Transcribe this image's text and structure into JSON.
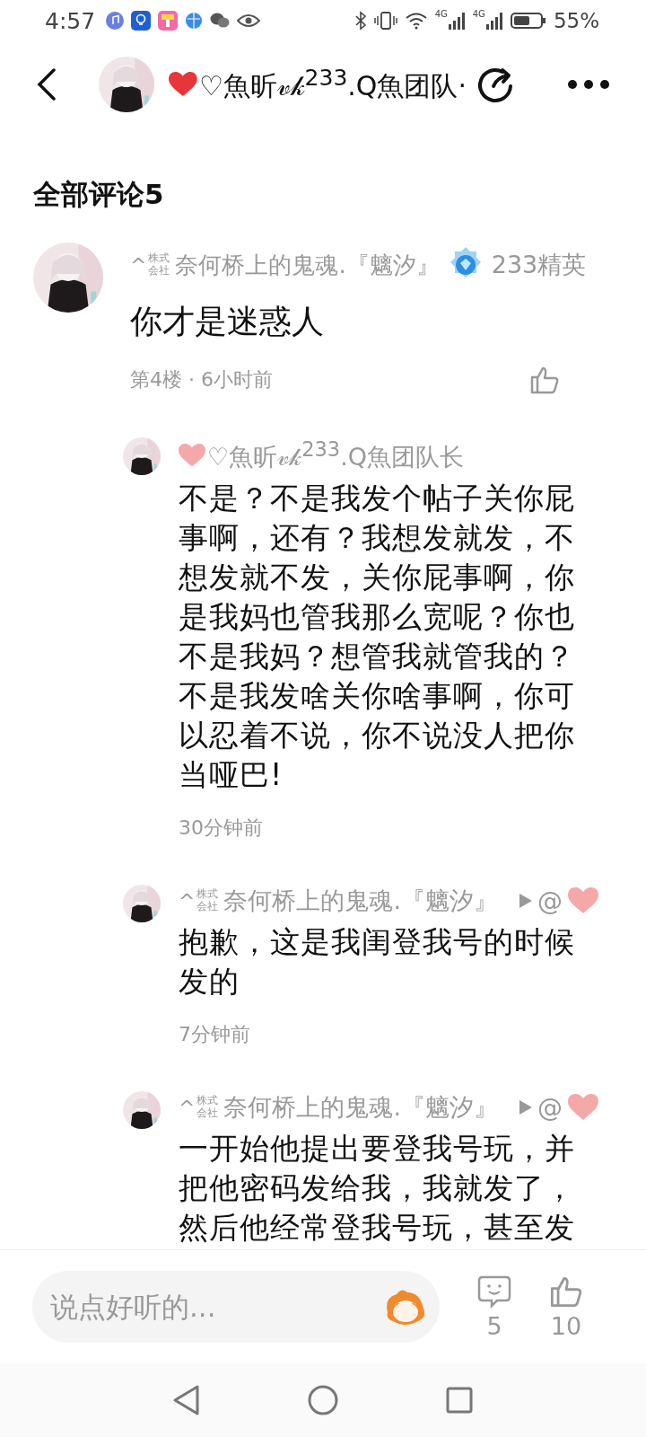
{
  "status_bar": {
    "time": "4:57",
    "network": [
      "4G",
      "4G"
    ],
    "battery": "55%"
  },
  "header": {
    "title": "♡魚昕𝓋𝓀$^{233}$.Q魚团队·",
    "heart": true
  },
  "comments_title": "全部评论5",
  "comment": {
    "name_prefix": "^",
    "name_tag": "株式会社",
    "name": "奈何桥上的鬼魂.『魑汐』",
    "badge": "233精英",
    "text": "你才是迷惑人",
    "meta": "第4楼 · 6小时前"
  },
  "replies": [
    {
      "heart": true,
      "name": "♡魚昕𝓋𝓀$^{233}$.Q魚团队长",
      "text": "不是？不是我发个帖子关你屁事啊，还有？我想发就发，不想发就不发，关你屁事啊，你是我妈也管我那么宽呢？你也不是我妈？想管我就管我的？不是我发啥关你啥事啊，你可以忍着不说，你不说没人把你当哑巴!",
      "time": "30分钟前"
    },
    {
      "heart": false,
      "name_prefix": "^",
      "name_tag": "株式会社",
      "name": "奈何桥上的鬼魂.『魑汐』",
      "reply_to": {
        "at": "@",
        "heart": true
      },
      "text": "抱歉，这是我闺登我号的时候发的",
      "time": "7分钟前"
    },
    {
      "heart": false,
      "name_prefix": "^",
      "name_tag": "株式会社",
      "name": "奈何桥上的鬼魂.『魑汐』",
      "reply_to": {
        "at": "@",
        "heart": true
      },
      "text": "一开始他提出要登我号玩，并把他密码发给我，我就发了，然后他经常登我号玩，甚至发"
    }
  ],
  "bottom_bar": {
    "placeholder": "说点好听的...",
    "comment_count": "5",
    "like_count": "10"
  }
}
